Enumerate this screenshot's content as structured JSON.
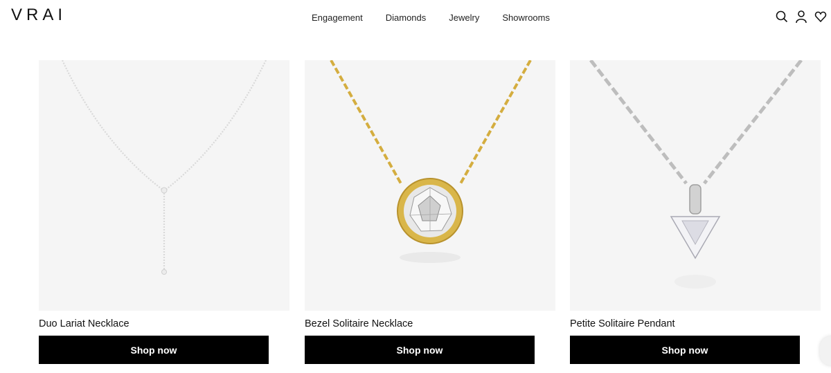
{
  "brand": {
    "logo_text": "VRAI"
  },
  "nav": {
    "items": [
      "Engagement",
      "Diamonds",
      "Jewelry",
      "Showrooms"
    ]
  },
  "header_icons": [
    "search-icon",
    "account-icon",
    "heart-icon"
  ],
  "products": [
    {
      "name": "Duo Lariat Necklace",
      "cta": "Shop now",
      "image": "lariat-necklace-image",
      "metal_color": "#d8d8d8"
    },
    {
      "name": "Bezel Solitaire Necklace",
      "cta": "Shop now",
      "image": "bezel-solitaire-image",
      "metal_color": "#d9b64a"
    },
    {
      "name": "Petite Solitaire Pendant",
      "cta": "Shop now",
      "image": "trillion-pendant-image",
      "metal_color": "#c9c9c9"
    }
  ],
  "colors": {
    "button_bg": "#000000",
    "button_text": "#ffffff",
    "tile_bg": "#f5f5f5"
  }
}
